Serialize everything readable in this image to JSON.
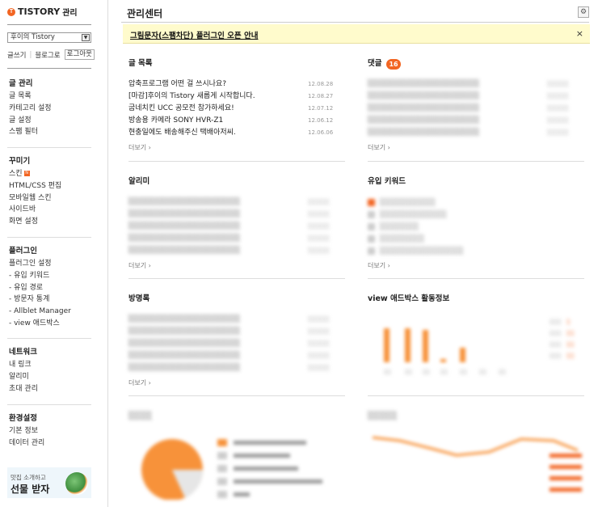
{
  "app": {
    "logo_text": "TISTORY",
    "logo_suffix": "관리"
  },
  "sidebar": {
    "blog_select_value": "후이의 Tistory",
    "links": {
      "write": "글쓰기",
      "blog": "블로그로",
      "logout": "로그아웃"
    },
    "groups": [
      {
        "title": "글 관리",
        "items": [
          "글 목록",
          "카테고리 설정",
          "글 설정",
          "스팸 필터"
        ]
      },
      {
        "title": "꾸미기",
        "items": [
          "스킨",
          "HTML/CSS 편집",
          "모바일웹 스킨",
          "사이드바",
          "화면 설정"
        ]
      },
      {
        "title": "플러그인",
        "items": [
          "플러그인 설정",
          "- 유입 키워드",
          "- 유입 경로",
          "- 방문자 통계",
          "- Allblet Manager",
          "- view 애드박스"
        ]
      },
      {
        "title": "네트워크",
        "items": [
          "내 링크",
          "알리미",
          "초대 관리"
        ]
      },
      {
        "title": "환경설정",
        "items": [
          "기본 정보",
          "데이터 관리"
        ]
      }
    ],
    "skin_badge": "N",
    "banner": {
      "line1": "맛집 소개하고",
      "line2": "선물 받자"
    }
  },
  "main": {
    "title": "관리센터",
    "settings_icon": "gear-icon",
    "notice": {
      "text": "그림문자(스팸차단) 플러그인 오픈 안내",
      "close": "×"
    },
    "posts": {
      "title": "글 목록",
      "rows": [
        {
          "title": "압축프로그램 어떤 걸 쓰시나요?",
          "date": "12.08.28"
        },
        {
          "title": "[마감]후이의 Tistory 새롭게 시작합니다.",
          "date": "12.08.27"
        },
        {
          "title": "굽네치킨 UCC 공모전 참가하세요!",
          "date": "12.07.12"
        },
        {
          "title": "방송용 카메라 SONY HVR-Z1",
          "date": "12.06.12"
        },
        {
          "title": "현충일에도 배송해주신 택배아저씨.",
          "date": "12.06.06"
        }
      ],
      "more": "더보기 ›"
    },
    "comments": {
      "title": "댓글",
      "count": "16",
      "more": "더보기 ›"
    },
    "notifications": {
      "title": "알리미",
      "more": "더보기 ›"
    },
    "keywords": {
      "title": "유입 키워드",
      "more": "더보기 ›"
    },
    "guestbook": {
      "title": "방명록",
      "more": "더보기 ›"
    },
    "adbox": {
      "title": "view 애드박스 활동정보"
    },
    "accent_color": "#f26522",
    "notice_bg": "#fffbcc"
  }
}
